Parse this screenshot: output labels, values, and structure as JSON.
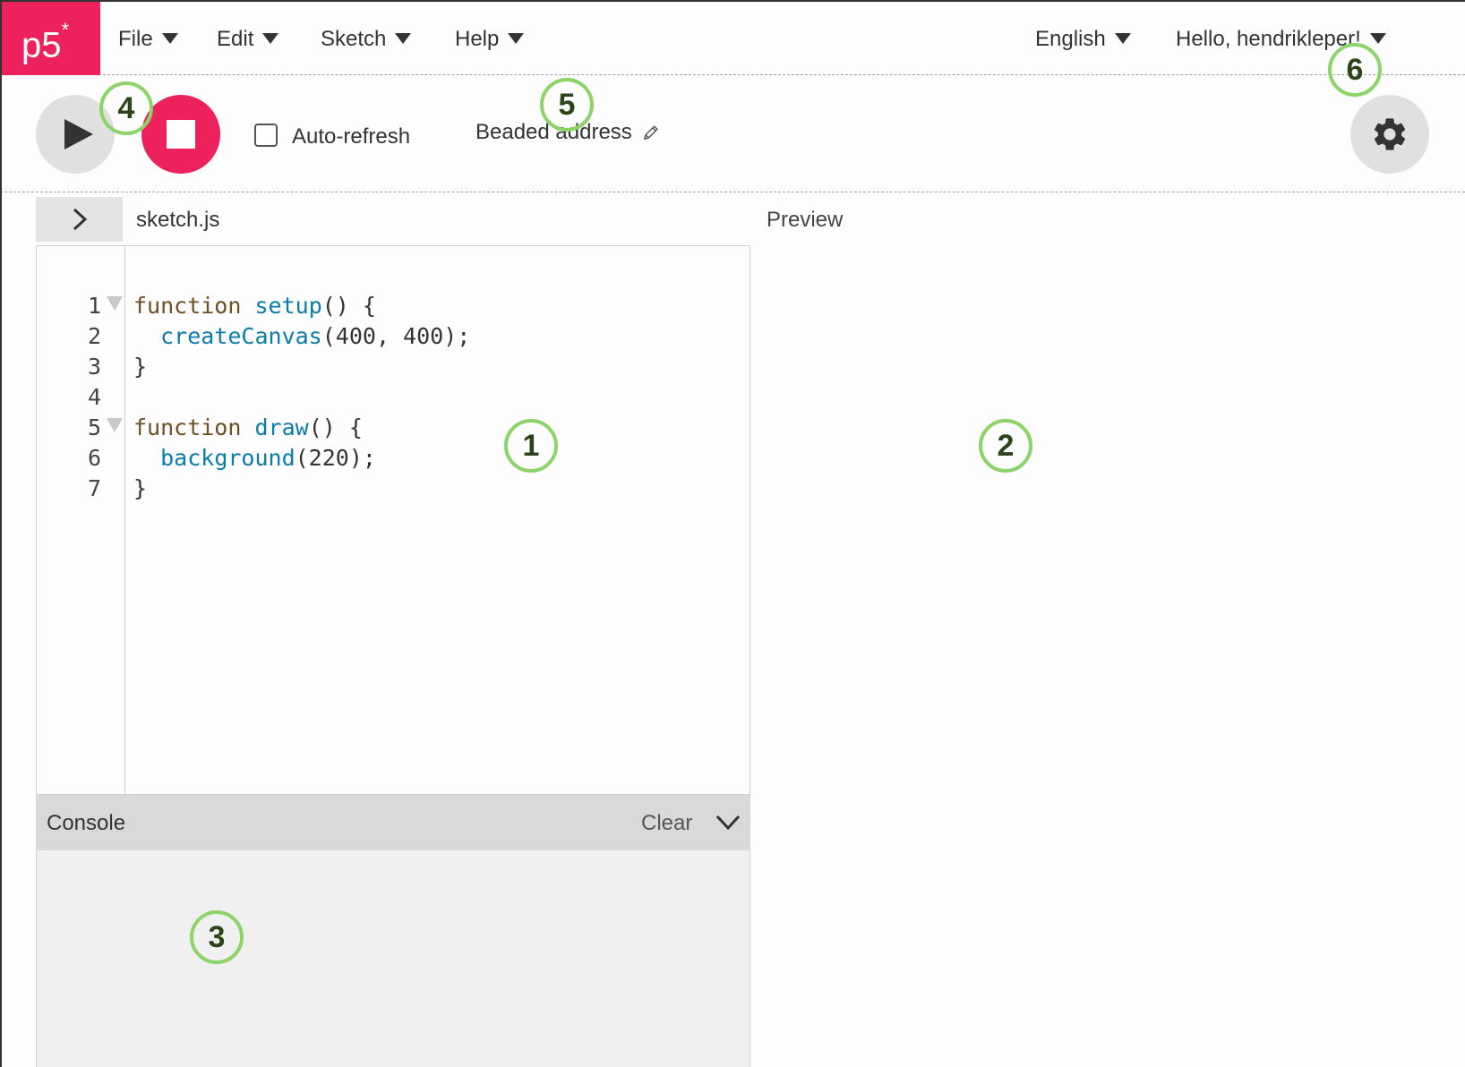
{
  "nav": {
    "logo": "p5",
    "logo_star": "*",
    "menus": [
      "File",
      "Edit",
      "Sketch",
      "Help"
    ],
    "language": "English",
    "user_greeting": "Hello, hendrikleper!"
  },
  "toolbar": {
    "auto_refresh_label": "Auto-refresh",
    "auto_refresh_checked": false,
    "sketch_name": "Beaded address",
    "icons": {
      "play": "play-icon",
      "stop": "stop-icon",
      "edit": "pencil-icon",
      "settings": "gear-icon"
    }
  },
  "editor": {
    "file_name": "sketch.js",
    "preview_label": "Preview",
    "line_numbers": [
      "1",
      "2",
      "3",
      "4",
      "5",
      "6",
      "7"
    ],
    "code": [
      "function setup() {",
      "  createCanvas(400, 400);",
      "}",
      "",
      "function draw() {",
      "  background(220);",
      "}"
    ]
  },
  "console": {
    "title": "Console",
    "clear_label": "Clear"
  },
  "annotations": [
    "1",
    "2",
    "3",
    "4",
    "5",
    "6"
  ],
  "colors": {
    "brand": "#ed225d",
    "marker": "#8cd36a",
    "keyword": "#704f21",
    "function": "#0b7ca9"
  }
}
